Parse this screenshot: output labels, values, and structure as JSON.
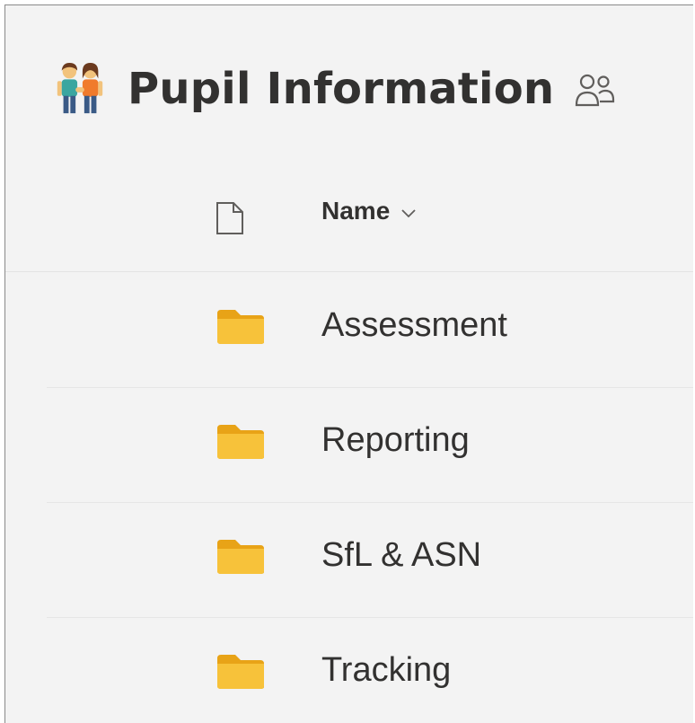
{
  "library": {
    "title": "Pupil Information"
  },
  "columns": {
    "name_label": "Name"
  },
  "items": [
    {
      "name": "Assessment",
      "type": "folder"
    },
    {
      "name": "Reporting",
      "type": "folder"
    },
    {
      "name": "SfL & ASN",
      "type": "folder"
    },
    {
      "name": "Tracking",
      "type": "folder"
    }
  ],
  "colors": {
    "background": "#f3f3f3",
    "text": "#323130",
    "folder": "#f7c23a",
    "divider": "#e3e3e3"
  },
  "icons": {
    "library": "people-holding-hands-icon",
    "group": "group-icon",
    "file_type": "document-icon",
    "sort": "chevron-down-icon",
    "item": "folder-icon"
  }
}
